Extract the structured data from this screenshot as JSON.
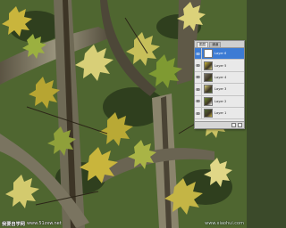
{
  "canvas": {
    "description_icon": "camouflage-leaf-texture",
    "colors": {
      "bark_dark": "#3d3526",
      "bark_light": "#8f8a72",
      "leaf_yellow": "#c9b53c",
      "leaf_green": "#6f8a2e",
      "leaf_pale": "#d8cf78",
      "background_green": "#4f6630"
    }
  },
  "layers_panel": {
    "tabs": [
      "图层",
      "通道"
    ],
    "layers": [
      {
        "name": "Layer 6",
        "selected": true,
        "visible": true
      },
      {
        "name": "Layer 5",
        "selected": false,
        "visible": true
      },
      {
        "name": "Layer 4",
        "selected": false,
        "visible": true
      },
      {
        "name": "Layer 3",
        "selected": false,
        "visible": true
      },
      {
        "name": "Layer 2",
        "selected": false,
        "visible": true
      },
      {
        "name": "Layer 1",
        "selected": false,
        "visible": true
      }
    ],
    "accent": "#3c7bd4"
  },
  "watermark": {
    "title": "我要自学网",
    "url": "www.51zxw.net",
    "right_text": "www.xiaohui.com"
  }
}
